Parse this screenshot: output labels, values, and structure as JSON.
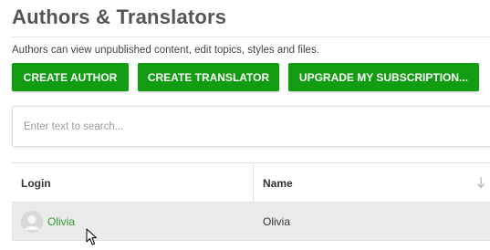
{
  "page": {
    "title": "Authors & Translators",
    "subtitle": "Authors can view unpublished content, edit topics, styles and files."
  },
  "actions": {
    "create_author": "CREATE AUTHOR",
    "create_translator": "CREATE TRANSLATOR",
    "upgrade": "UPGRADE MY SUBSCRIPTION..."
  },
  "search": {
    "placeholder": "Enter text to search...",
    "value": ""
  },
  "table": {
    "columns": [
      {
        "label": "Login"
      },
      {
        "label": "Name",
        "sort": "descending",
        "sort_icon": "arrow-down-icon"
      }
    ],
    "rows": [
      {
        "login": "Olivia",
        "name": "Olivia",
        "avatar_icon": "user-avatar-icon"
      }
    ]
  },
  "colors": {
    "accent_green": "#119c11",
    "link_green": "#2e9a2e",
    "row_highlight": "#ebebeb"
  }
}
